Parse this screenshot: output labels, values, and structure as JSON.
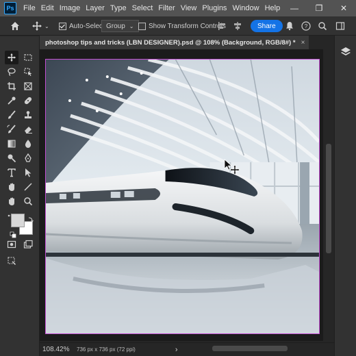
{
  "app": {
    "logo": "Ps"
  },
  "menu": [
    "File",
    "Edit",
    "Image",
    "Layer",
    "Type",
    "Select",
    "Filter",
    "View",
    "Plugins",
    "Window",
    "Help"
  ],
  "window_controls": {
    "minimize": "—",
    "restore": "❐",
    "close": "✕"
  },
  "options": {
    "auto_select_label": "Auto-Select:",
    "auto_select_checked": true,
    "group_value": "Group",
    "show_transform_label": "Show Transform Controls",
    "share_label": "Share"
  },
  "document": {
    "tab_title": "photoshop tips and tricks (LBN DESIGNER).psd @ 108% (Background, RGB/8#) *",
    "close_glyph": "×"
  },
  "status": {
    "zoom": "108.42%",
    "info": "736 px x 736 px (72 ppi)",
    "arrow": "›"
  },
  "colors": {
    "accent": "#1473e6",
    "canvas_border": "#c44fd3",
    "ui_dark": "#323232",
    "foreground_swatch": "#d8d8d8",
    "background_swatch": "#ffffff"
  },
  "toolbar": {
    "tools": [
      [
        "move-icon",
        "marquee-icon"
      ],
      [
        "lasso-icon",
        "object-select-icon"
      ],
      [
        "crop-icon",
        "frame-icon"
      ],
      [
        "eyedropper-icon",
        "healing-icon"
      ],
      [
        "brush-icon",
        "stamp-icon"
      ],
      [
        "history-brush-icon",
        "eraser-icon"
      ],
      [
        "gradient-icon",
        "blur-icon"
      ],
      [
        "dodge-icon",
        "pen-tool-icon"
      ],
      [
        "type-icon",
        "path-select-icon"
      ],
      [
        "line-icon",
        "hand-icon"
      ],
      [
        "zoom-icon",
        "more-tools-icon"
      ]
    ]
  }
}
